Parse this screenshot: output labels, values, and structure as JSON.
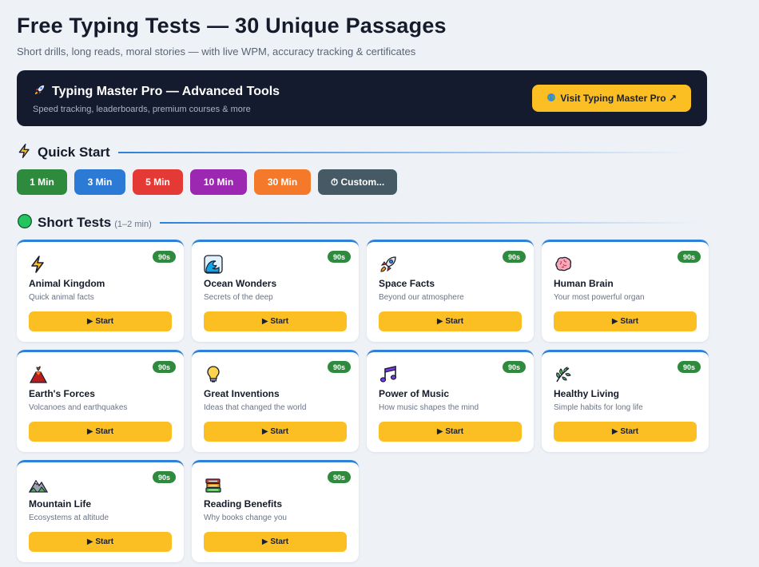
{
  "header": {
    "title": "Free Typing Tests — 30 Unique Passages",
    "subtitle": "Short drills, long reads, moral stories — with live WPM, accuracy tracking & certificates"
  },
  "promo": {
    "title": "Typing Master Pro — Advanced Tools",
    "description": "Speed tracking, leaderboards, premium courses & more",
    "button_label": "Visit Typing Master Pro ↗",
    "icon": "rocket-icon",
    "button_icon": "globe-icon"
  },
  "quick_start": {
    "title": "Quick Start",
    "icon": "lightning-icon",
    "buttons": [
      {
        "label": "1 Min",
        "color": "#2e8b3e"
      },
      {
        "label": "3 Min",
        "color": "#2b7bd6"
      },
      {
        "label": "5 Min",
        "color": "#e53935"
      },
      {
        "label": "10 Min",
        "color": "#9c27b0"
      },
      {
        "label": "30 Min",
        "color": "#f5792a"
      },
      {
        "label": "⏱ Custom...",
        "color": "#455a64"
      }
    ]
  },
  "short_tests": {
    "title": "Short Tests",
    "subtitle": "(1–2 min)",
    "icon": "green-circle-icon",
    "start_label": "▶ Start",
    "cards": [
      {
        "icon": "lightning-icon",
        "title": "Animal Kingdom",
        "description": "Quick animal facts",
        "badge": "90s"
      },
      {
        "icon": "wave-icon",
        "title": "Ocean Wonders",
        "description": "Secrets of the deep",
        "badge": "90s"
      },
      {
        "icon": "rocket-icon",
        "title": "Space Facts",
        "description": "Beyond our atmosphere",
        "badge": "90s"
      },
      {
        "icon": "brain-icon",
        "title": "Human Brain",
        "description": "Your most powerful organ",
        "badge": "90s"
      },
      {
        "icon": "volcano-icon",
        "title": "Earth's Forces",
        "description": "Volcanoes and earthquakes",
        "badge": "90s"
      },
      {
        "icon": "lightbulb-icon",
        "title": "Great Inventions",
        "description": "Ideas that changed the world",
        "badge": "90s"
      },
      {
        "icon": "music-notes-icon",
        "title": "Power of Music",
        "description": "How music shapes the mind",
        "badge": "90s"
      },
      {
        "icon": "herb-icon",
        "title": "Healthy Living",
        "description": "Simple habits for long life",
        "badge": "90s"
      },
      {
        "icon": "mountain-icon",
        "title": "Mountain Life",
        "description": "Ecosystems at altitude",
        "badge": "90s"
      },
      {
        "icon": "books-icon",
        "title": "Reading Benefits",
        "description": "Why books change you",
        "badge": "90s"
      }
    ]
  }
}
